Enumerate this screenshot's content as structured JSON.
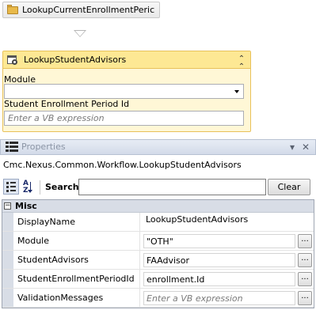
{
  "designer": {
    "top_activity_title": "LookupCurrentEnrollmentPeric",
    "activity_title": "LookupStudentAdvisors",
    "module_label": "Module",
    "module_value": "",
    "period_label": "Student Enrollment Period Id",
    "period_placeholder": "Enter a VB expression"
  },
  "properties": {
    "title": "Properties",
    "type_name": "Cmc.Nexus.Common.Workflow.LookupStudentAdvisors",
    "search_label": "Search:",
    "search_value": "",
    "clear_label": "Clear",
    "category": "Misc",
    "category_toggle": "−",
    "rows": [
      {
        "name": "DisplayName",
        "value": "LookupStudentAdvisors"
      },
      {
        "name": "Module",
        "value": "\"OTH\""
      },
      {
        "name": "StudentAdvisors",
        "value": "FAAdvisor"
      },
      {
        "name": "StudentEnrollmentPeriodId",
        "value": "enrollment.Id"
      },
      {
        "name": "ValidationMessages",
        "value": "Enter a VB expression"
      }
    ],
    "ellipsis_label": "...",
    "pin_glyph": "▾",
    "close_glyph": "✕"
  },
  "icons": {
    "folder": "folder-icon",
    "activity": "lookup-activity-icon",
    "collapse": "double-chevron-up-icon",
    "grid": "properties-grid-icon",
    "categorized": "categorized-view-icon",
    "alphabetical": "sort-az-icon"
  }
}
